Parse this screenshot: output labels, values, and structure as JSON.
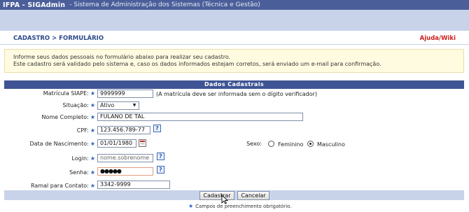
{
  "header": {
    "system_name": "IFPA - SIGAdmin",
    "system_desc": "- Sistema de Administração dos Sistemas (Técnica e Gestão)"
  },
  "subheader": {
    "breadcrumb": "CADASTRO > FORMULÁRIO",
    "help_link": "Ajuda/Wiki"
  },
  "info": {
    "line1": "Informe seus dados pessoais no formulário abaixo para realizar seu cadastro.",
    "line2": "Este cadastro será validado pelo sistema e, caso os dados informados estejam corretos, será enviado um e-mail para confirmação."
  },
  "form": {
    "title": "Dados Cadastrais",
    "required_mark": "★",
    "matricula": {
      "label": "Matrícula SIAPE:",
      "value": "9999999",
      "hint": "(A matrícula deve ser informada sem o dígito verificador)"
    },
    "situacao": {
      "label": "Situação:",
      "value": "Ativo"
    },
    "nome": {
      "label": "Nome Completo:",
      "value": "FULANO DE TAL"
    },
    "cpf": {
      "label": "CPF:",
      "value": "123.456.789-77"
    },
    "nascimento": {
      "label": "Data de Nascimento:",
      "value": "01/01/1980"
    },
    "sexo": {
      "label": "Sexo:",
      "options": [
        "Feminino",
        "Masculino"
      ],
      "selected": "Masculino"
    },
    "login": {
      "label": "Login:",
      "value": "nome.sobrenome"
    },
    "senha": {
      "label": "Senha:",
      "value": "●●●●●"
    },
    "ramal": {
      "label": "Ramal para Contato:",
      "value": "3342-9999"
    },
    "help_glyph": "?"
  },
  "actions": {
    "submit_label": "Cadastrar",
    "cancel_label": "Cancelar"
  },
  "legend": "Campos de preenchimento obrigatório.",
  "colors": {
    "header_bg": "#4a5f9a",
    "panel_head_bg": "#3e5494",
    "help_link": "#cc1f1f",
    "required_star": "#2b61c4"
  }
}
